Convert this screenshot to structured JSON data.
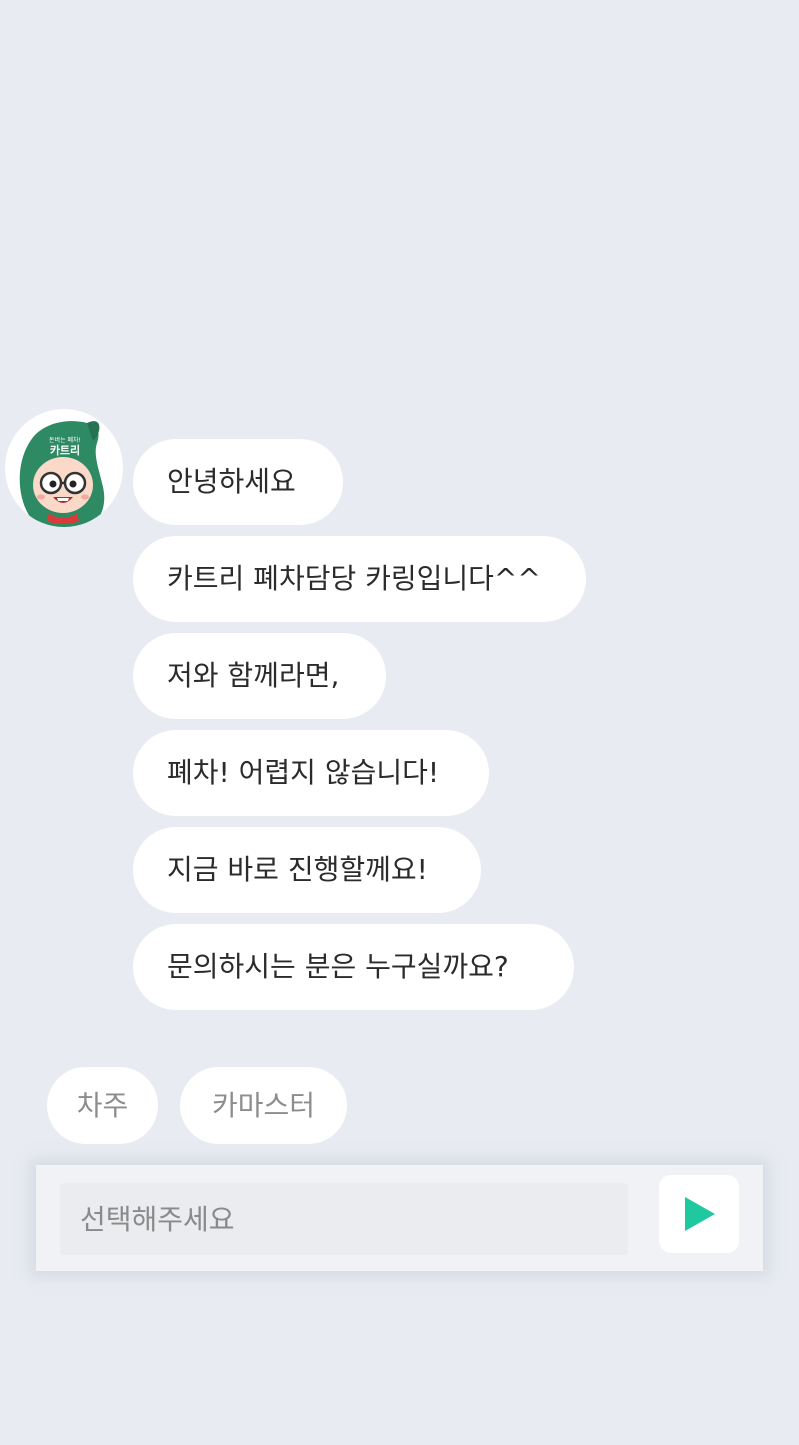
{
  "chat": {
    "bot": {
      "avatar_text_small": "돈버는 폐차!",
      "avatar_text_big": "카트리"
    },
    "messages": [
      {
        "text": "안녕하세요"
      },
      {
        "text": "카트리 폐차담당 카링입니다^^"
      },
      {
        "text": "저와 함께라면,"
      },
      {
        "text": "폐차! 어렵지 않습니다!"
      },
      {
        "text": "지금 바로 진행할께요!"
      },
      {
        "text": "문의하시는 분은 누구실까요?"
      }
    ],
    "choices": [
      {
        "label": "차주"
      },
      {
        "label": "카마스터"
      }
    ]
  },
  "composer": {
    "placeholder": "선택해주세요",
    "value": "",
    "send_icon": "play-triangle-icon",
    "accent_color": "#1ec9a0"
  },
  "colors": {
    "background": "#e8ebf2",
    "bubble": "#ffffff",
    "mascot_green": "#2e8a63"
  }
}
